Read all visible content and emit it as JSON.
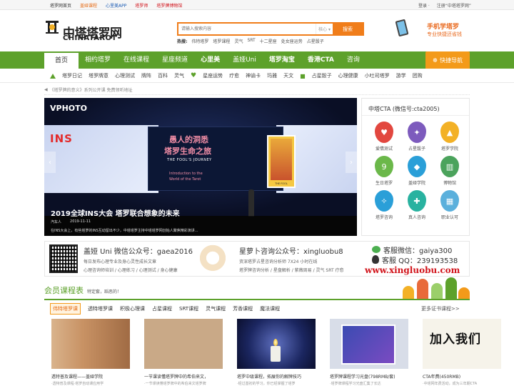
{
  "topbar": {
    "links": [
      "塔罗网首页",
      "盖娅课程",
      "心里美APP",
      "塔罗师",
      "塔罗牌博物馆"
    ],
    "link_colors": [
      "#333333",
      "#e66c16",
      "#1a5ab3",
      "#d1131a",
      "#d1131a"
    ],
    "login": "登录 ·",
    "register": "注册“中塔塔罗网”"
  },
  "logo": {
    "cn": "中塔塔罗网",
    "en": "CHINATAROT"
  },
  "search": {
    "placeholder": "请输入搜索内容",
    "scope": "核心 ▾",
    "button": "搜索",
    "hot_label": "热搜:",
    "hot": [
      "伟特塔罗",
      "塔罗课程",
      "灵气",
      "SRT",
      "十二星座",
      "处女座运势",
      "占星骰子"
    ]
  },
  "promo": {
    "line1": "手机学塔罗",
    "line2": "专业快捷还省钱"
  },
  "nav": {
    "items": [
      "首页",
      "相约塔罗",
      "在线课程",
      "星座频道",
      "心里美",
      "盖娅Uni",
      "塔罗淘宝",
      "香港CTA",
      "咨询"
    ],
    "quick": "快捷导航"
  },
  "subnav": {
    "group1": [
      "塔罗日记",
      "塔罗牌意",
      "心理测试",
      "牌阵",
      "百科",
      "灵气"
    ],
    "group2": [
      "星座运势",
      "疗愈",
      "神谕卡",
      "玛雅",
      "天文"
    ],
    "group3": [
      "占星骰子",
      "心理健康",
      "小吐司塔罗",
      "游学",
      "团购"
    ]
  },
  "breadcrumb": "《塔罗牌的意义》系列公开课 免费领听地址",
  "slider": {
    "brand": "VPHOTO",
    "ins": "INS",
    "headline1": "愚人的洞悉",
    "headline2": "塔罗生命之旅",
    "english": "THE FOOL'S JOURNEY",
    "intro1": "Introduction to the",
    "intro2": "World of the Tarot",
    "card_caption": "THE FOOL",
    "title": "2019全球INS大会 塔罗联合想象的未来",
    "author": "汽车人",
    "date": "2019-11-11",
    "desc": "在INS大会上，有些塔罗的INS互动留出不少，中塔塔罗主持中塔塔罗网创始人聚焦精彩演讲..."
  },
  "cta": {
    "title": "中塔CTA (微信号:cta2005)",
    "items": [
      {
        "label": "爱情测试",
        "icon": "heart-card-icon",
        "color": "#e2473f"
      },
      {
        "label": "占星骰子",
        "icon": "dice-icon",
        "color": "#7d5bbd"
      },
      {
        "label": "塔罗学院",
        "icon": "graduation-cap-icon",
        "color": "#f3b126"
      },
      {
        "label": "生日塔罗",
        "icon": "number-nine-icon",
        "color": "#6bb84a"
      },
      {
        "label": "盖娅学院",
        "icon": "mortarboard-icon",
        "color": "#2a9fd8"
      },
      {
        "label": "博物馆",
        "icon": "museum-icon",
        "color": "#4ba35c"
      },
      {
        "label": "塔罗咨询",
        "icon": "tarot-consult-icon",
        "color": "#2a9fd8"
      },
      {
        "label": "真人咨询",
        "icon": "handshake-icon",
        "color": "#29b2a0"
      },
      {
        "label": "职业认可",
        "icon": "bank-icon",
        "color": "#5bb0dc"
      }
    ]
  },
  "qr": {
    "gaea_title": "盖娅 Uni 微信公众号：gaea2016",
    "gaea_line1": "每日发布心理专业及身心灵性成长文章",
    "gaea_line2": "心理咨询师培训 / 心理练习 / 心理测试 / 身心健康",
    "xlb_title": "星萝卜咨询公众号：xingluobu8",
    "xlb_line1": "资深塔罗占星咨询分析师 7X24 小时在线",
    "xlb_line2": "塔罗牌咨询分析 / 星盘解析 / 紫薇周易 / 灵气 SRT 疗愈",
    "wechat": "客服微信：gaiya300",
    "qq": "客服 QQ：239193538",
    "url": "www.xingluobu.com"
  },
  "courses": {
    "title": "会员课程表",
    "subtitle": "特定套，蹈恶的！",
    "tabs": [
      "伟特塔罗课",
      "透特塔罗课",
      "积极心理课",
      "占星课程",
      "SRT课程",
      "灵气课程",
      "芳香课程",
      "魔法课程"
    ],
    "more": "更多证书课程>>",
    "cards": [
      {
        "title": "透特普及课程——盖娅学院",
        "sub": "·透特普及课程·塔罗自动课应用学"
      },
      {
        "title": "一节课读懂塔罗牌中的希伯来文，",
        "sub": "·一节课读懂塔罗牌中的希伯来文塔罗牌"
      },
      {
        "title": "塔罗中级课程，拓展你的解牌技巧",
        "sub": "·经过基初的学习，你已经掌握了塔罗"
      },
      {
        "title": "塔罗牌课程学习光盘(798RMB/套)",
        "sub": "·塔罗牌课程学习光盘汇集了长达"
      },
      {
        "title": "CTA年费(450RMB)",
        "sub": "·中塔网年费活动，成为三年期CTA"
      }
    ],
    "card5_text": "加入我们"
  }
}
